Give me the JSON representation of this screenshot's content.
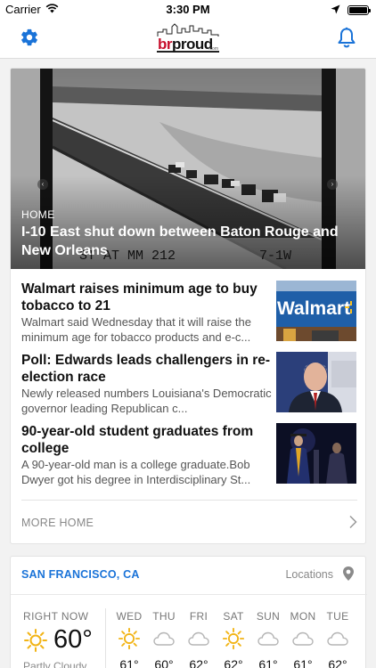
{
  "status_bar": {
    "carrier": "Carrier",
    "time": "3:30 PM",
    "battery_level": 1.0
  },
  "nav": {
    "settings_icon": "gear-icon",
    "notifications_icon": "bell-icon",
    "logo": {
      "part1": "br",
      "part2": "proud",
      "suffix": ".com"
    },
    "accent_color": "#1a73d8"
  },
  "news": {
    "hero": {
      "category": "HOME",
      "title": "I-10 East shut down between Baton Rouge and New Orleans"
    },
    "stories": [
      {
        "title": "Walmart raises minimum age to buy tobacco to 21",
        "summary": "Walmart said Wednesday that it will raise the minimum age for tobacco products and e-c...",
        "thumb_text": "Walmart"
      },
      {
        "title": "Poll: Edwards leads challengers in re-election race",
        "summary": "Newly released numbers Louisiana's Democratic governor leading Republican c..."
      },
      {
        "title": "90-year-old student graduates from college",
        "summary": "A 90-year-old man is a college graduate.Bob Dwyer got his degree in Interdisciplinary St..."
      }
    ],
    "more_label": "MORE HOME"
  },
  "weather": {
    "location": "SAN FRANCISCO, CA",
    "locations_label": "Locations",
    "now": {
      "label": "RIGHT NOW",
      "temp": "60°",
      "condition": "Partly Cloudy",
      "icon": "sun-icon"
    },
    "days": [
      {
        "name": "WED",
        "icon": "sun-icon",
        "temp": "61°"
      },
      {
        "name": "THU",
        "icon": "cloud-icon",
        "temp": "60°"
      },
      {
        "name": "FRI",
        "icon": "cloud-icon",
        "temp": "62°"
      },
      {
        "name": "SAT",
        "icon": "sun-icon",
        "temp": "62°"
      },
      {
        "name": "SUN",
        "icon": "cloud-icon",
        "temp": "61°"
      },
      {
        "name": "MON",
        "icon": "cloud-icon",
        "temp": "61°"
      },
      {
        "name": "TUE",
        "icon": "cloud-icon",
        "temp": "62°"
      }
    ]
  }
}
